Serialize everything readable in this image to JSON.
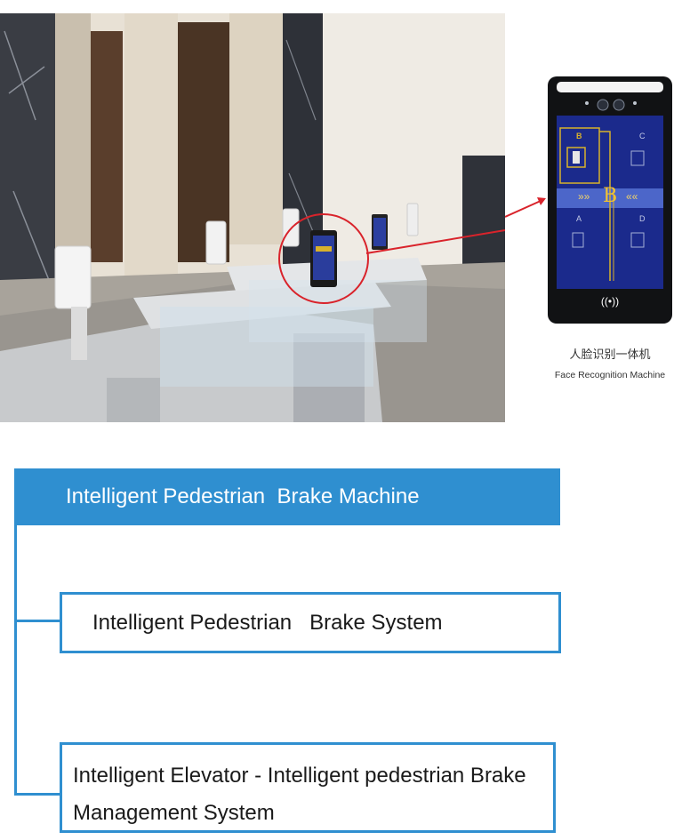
{
  "photo": {
    "screen_label": "B"
  },
  "device": {
    "floor_labels": [
      "B",
      "C",
      "A",
      "D"
    ],
    "banner_letter": "B",
    "banner_arrows_left": "»»",
    "banner_arrows_right": "««",
    "nfc_symbol": "((•))"
  },
  "caption": {
    "chinese": "人脸识别一体机",
    "english": "Face Recognition Machine"
  },
  "diagram": {
    "root": "Intelligent Pedestrian  Brake Machine",
    "children": [
      "Intelligent Pedestrian   Brake System",
      "Intelligent Elevator -   Intelligent pedestrian Brake Management System"
    ]
  },
  "colors": {
    "accent": "#2f8fd0",
    "pointer": "#d9232b"
  }
}
